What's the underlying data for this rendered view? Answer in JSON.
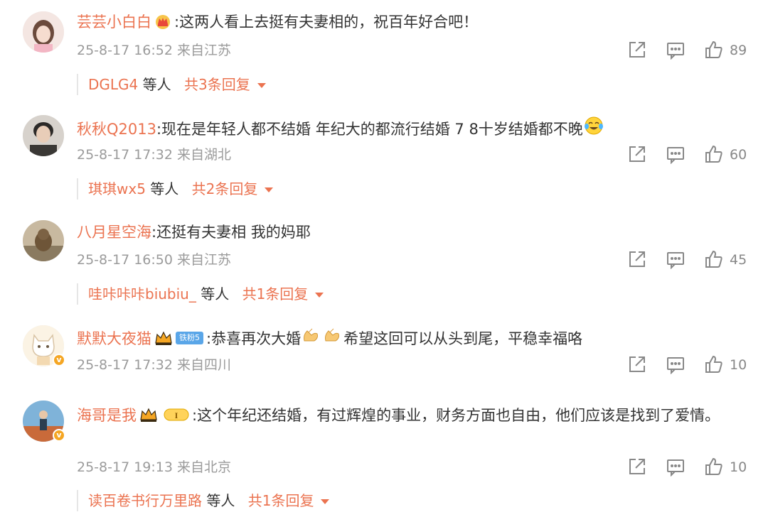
{
  "comments": [
    {
      "user": "芸芸小白白",
      "text": ":这两人看上去挺有夫妻相的，祝百年好合吧！",
      "time": "25-8-17 16:52",
      "location": "来自江苏",
      "likes": "89",
      "reply_user": "DGLG4",
      "reply_mid": "等人",
      "reply_total": "共3条回复"
    },
    {
      "user": "秋秋Q2013",
      "text": ":现在是年轻人都不结婚  年纪大的都流行结婚 7 8十岁结婚都不晚",
      "time": "25-8-17 17:32",
      "location": "来自湖北",
      "likes": "60",
      "reply_user": "琪琪wx5",
      "reply_mid": "等人",
      "reply_total": "共2条回复"
    },
    {
      "user": "八月星空海",
      "text": ":还挺有夫妻相 我的妈耶",
      "time": "25-8-17 16:50",
      "location": "来自江苏",
      "likes": "45",
      "reply_user": "哇咔咔咔biubiu_",
      "reply_mid": "等人",
      "reply_total": "共1条回复"
    },
    {
      "user": "默默大夜猫",
      "fan_badge": "铁粉5",
      "text": ":恭喜再次大婚",
      "text_after": "希望这回可以从头到尾，平稳幸福咯",
      "time": "25-8-17 17:32",
      "location": "来自四川",
      "likes": "10"
    },
    {
      "user": "海哥是我",
      "text": ":这个年纪还结婚，有过辉煌的事业，财务方面也自由，他们应该是找到了爱情。",
      "time": "25-8-17 19:13",
      "location": "来自北京",
      "likes": "10",
      "reply_user": "读百卷书行万里路",
      "reply_mid": "等人",
      "reply_total": "共1条回复"
    }
  ],
  "icons": [
    "share-icon",
    "comment-icon",
    "like-icon",
    "crown-icon",
    "clapping-hands-icon",
    "laughing-crying-emoji-icon",
    "verified-v-icon"
  ],
  "colors": {
    "username": "#eb7350",
    "meta": "#9b9b9b",
    "text": "#333333",
    "fan_badge": "#5aa6e8",
    "vip_gold": "#f5a623"
  }
}
